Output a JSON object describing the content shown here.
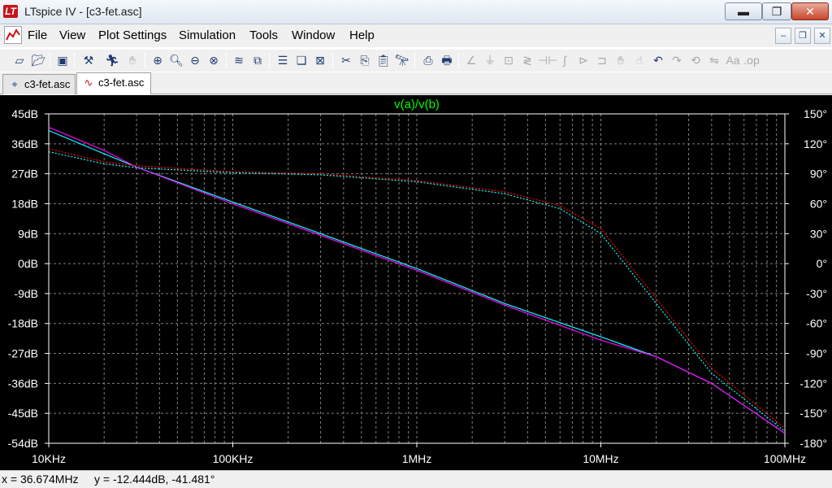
{
  "window": {
    "title": "LTspice IV - [c3-fet.asc]",
    "minimize_icon": "minimize-icon",
    "maximize_icon": "restore-icon",
    "close_icon": "close-icon"
  },
  "menu": {
    "items": [
      "File",
      "View",
      "Plot Settings",
      "Simulation",
      "Tools",
      "Window",
      "Help"
    ]
  },
  "toolbar": {
    "icons": [
      "new-schematic-icon",
      "open-icon",
      "save-icon",
      "control-panel-icon",
      "run-icon",
      "halt-icon",
      "zoom-in-icon",
      "zoom-area-icon",
      "zoom-out-icon",
      "zoom-cancel-icon",
      "autorange-icon",
      "zoom-full-icon",
      "tile-horizontal-icon",
      "cascade-icon",
      "close-window-icon",
      "cut-icon",
      "copy-icon",
      "paste-icon",
      "find-icon",
      "print-preview-icon",
      "print-icon",
      "wire-icon",
      "ground-icon",
      "label-net-icon",
      "resistor-icon",
      "capacitor-icon",
      "inductor-icon",
      "diode-icon",
      "component-icon",
      "move-icon",
      "drag-icon",
      "undo-icon",
      "redo-icon",
      "rotate-icon",
      "mirror-icon",
      "text-icon",
      "spice-directive-icon"
    ]
  },
  "tabs": [
    {
      "label": "c3-fet.asc",
      "icon": "schematic-icon",
      "active": false
    },
    {
      "label": "c3-fet.asc",
      "icon": "waveform-icon",
      "active": true
    }
  ],
  "plot": {
    "trace_label": "v(a)/v(b)",
    "trace_color": "#00ff00",
    "left_axis_ticks": [
      "45dB",
      "36dB",
      "27dB",
      "18dB",
      "9dB",
      "0dB",
      "-9dB",
      "-18dB",
      "-27dB",
      "-36dB",
      "-45dB",
      "-54dB"
    ],
    "right_axis_ticks": [
      "150°",
      "120°",
      "90°",
      "60°",
      "30°",
      "0°",
      "-30°",
      "-60°",
      "-90°",
      "-120°",
      "-150°",
      "-180°"
    ],
    "x_axis_ticks": [
      "10KHz",
      "100KHz",
      "1MHz",
      "10MHz",
      "100MHz"
    ]
  },
  "chart_data": {
    "type": "line",
    "title": "v(a)/v(b)",
    "x_scale": "log",
    "xlim": [
      10000,
      100000000
    ],
    "ylim_left": [
      -54,
      45
    ],
    "ylim_right": [
      -180,
      150
    ],
    "grid": true,
    "series": [
      {
        "name": "",
        "color": "#00ffff",
        "kind": "magnitude",
        "x": [
          10000,
          20000,
          30000,
          100000,
          300000,
          1000000,
          3000000,
          10000000,
          20000000,
          40000000,
          100000000
        ],
        "y": [
          40,
          33,
          29,
          18.5,
          9,
          -1.5,
          -12,
          -22,
          -28,
          -36,
          -51
        ]
      },
      {
        "name": "",
        "color": "#ff00ff",
        "kind": "magnitude",
        "x": [
          10000,
          20000,
          30000,
          100000,
          300000,
          1000000,
          3000000,
          10000000,
          20000000,
          40000000,
          100000000
        ],
        "y": [
          41,
          34,
          29,
          18,
          8.5,
          -2,
          -12.5,
          -23,
          -28,
          -36,
          -51
        ]
      },
      {
        "name": "",
        "color": "#00ffff",
        "kind": "phase",
        "x": [
          10000,
          20000,
          30000,
          100000,
          300000,
          1000000,
          3000000,
          6000000,
          10000000,
          20000000,
          40000000,
          100000000
        ],
        "y": [
          112,
          100,
          96,
          91,
          89,
          82,
          70,
          55,
          30,
          -40,
          -110,
          -168
        ]
      },
      {
        "name": "",
        "color": "#ff0000",
        "kind": "phase",
        "x": [
          10000,
          20000,
          30000,
          100000,
          300000,
          1000000,
          3000000,
          6000000,
          10000000,
          20000000,
          40000000,
          100000000
        ],
        "y": [
          115,
          102,
          98,
          92,
          90,
          83,
          72,
          58,
          35,
          -35,
          -105,
          -165
        ]
      }
    ]
  },
  "status": {
    "cursor": "x = 36.674MHz     y = -12.444dB, -41.481°"
  }
}
